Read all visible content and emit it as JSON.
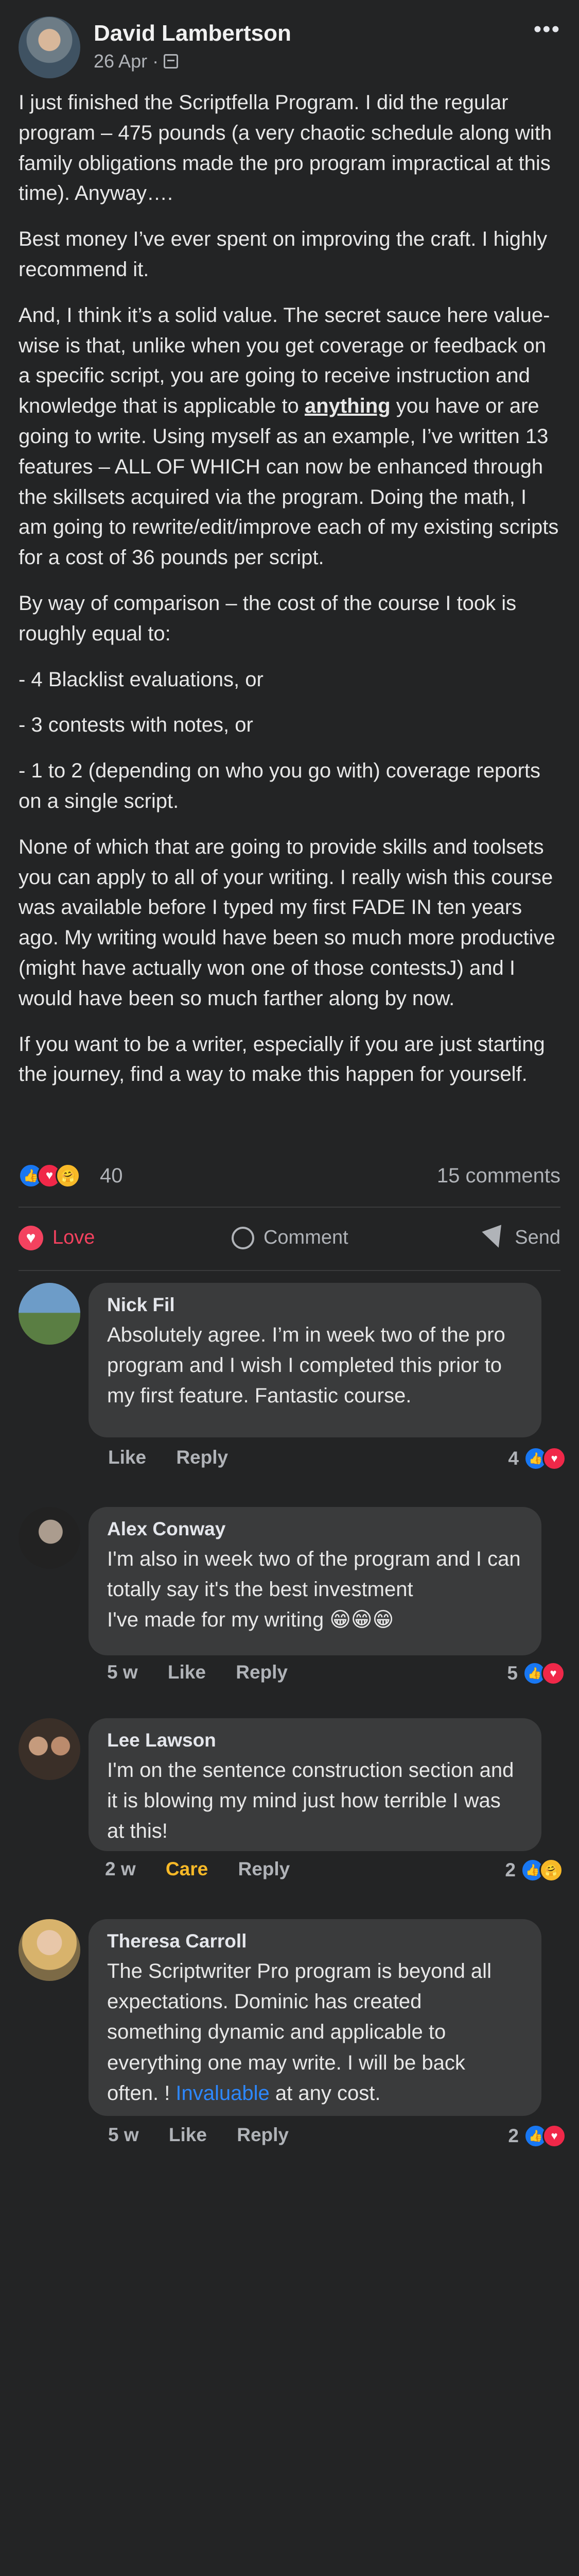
{
  "post": {
    "author": "David Lambertson",
    "date": "26 Apr",
    "separator": "·",
    "more_icon": "more-icon",
    "paragraphs": [
      "I just finished the Scriptfella Program.  I did the regular program – 475 pounds (a very chaotic schedule along with family obligations made the pro program impractical at this time). Anyway….",
      "Best money I’ve ever spent on improving the craft. I highly recommend it.",
      "And, I think it’s a solid value. The secret sauce here value-wise is that, unlike when you get coverage or feedback on a specific script, you are going to receive instruction and knowledge that is applicable to ",
      "anything",
      " you have or are going to write. Using myself as an example, I’ve written 13 features – ALL OF WHICH can now be enhanced through the skillsets acquired via the program.  Doing the math,  I am going to rewrite/edit/improve each of my existing scripts for a cost of 36 pounds per script.",
      "By way of comparison – the cost of the course I took is roughly equal to:",
      "- 4 Blacklist evaluations, or",
      "- 3 contests with notes, or",
      "- 1 to 2 (depending on who you go with) coverage reports on a single script.",
      "None of which that are going to provide skills and toolsets you can apply to all of your writing. I really wish this course was available before I typed my first FADE IN ten years ago. My writing would have been so much more productive (might have actually won one of those contestsJ) and I would have been so much farther along by now.",
      "If you want to be a writer, especially if you are just starting the journey, find a way to make this happen for yourself."
    ]
  },
  "stats": {
    "reaction_count": "40",
    "comments_label": "15 comments"
  },
  "actions": {
    "love": "Love",
    "comment": "Comment",
    "send": "Send"
  },
  "comments": [
    {
      "name": "Nick Fil",
      "text": "Absolutely agree. I’m in week two of the pro program and I wish I completed this prior to my first feature. Fantastic course.",
      "time": "",
      "like": "Like",
      "reply": "Reply",
      "reaction_count": "4"
    },
    {
      "name": "Alex Conway",
      "text_line1": "I'm also in week two of the program and I can totally say it's the best investment",
      "text_line2": "I've made for my writing 😁😁😁",
      "time": "5 w",
      "like": "Like",
      "reply": "Reply",
      "reaction_count": "5"
    },
    {
      "name": "Lee Lawson",
      "text": "I'm on the sentence construction section and it is blowing my mind just how terrible I was at this!",
      "time": "2 w",
      "like": "Care",
      "reply": "Reply",
      "reaction_count": "2"
    },
    {
      "name": "Theresa Carroll",
      "text_before": "The Scriptwriter Pro program is beyond all expectations. Dominic has created something dynamic and applicable to everything one may write. I will be back often. ! ",
      "text_link": "Invaluable",
      "text_after": " at any cost.",
      "time": "5 w",
      "like": "Like",
      "reply": "Reply",
      "reaction_count": "2"
    }
  ],
  "colors": {
    "background": "#232425",
    "comment_bubble": "#3a3b3c",
    "love": "#f3425f",
    "like": "#1877f2",
    "care": "#f7b928",
    "link": "#2d88ff"
  }
}
